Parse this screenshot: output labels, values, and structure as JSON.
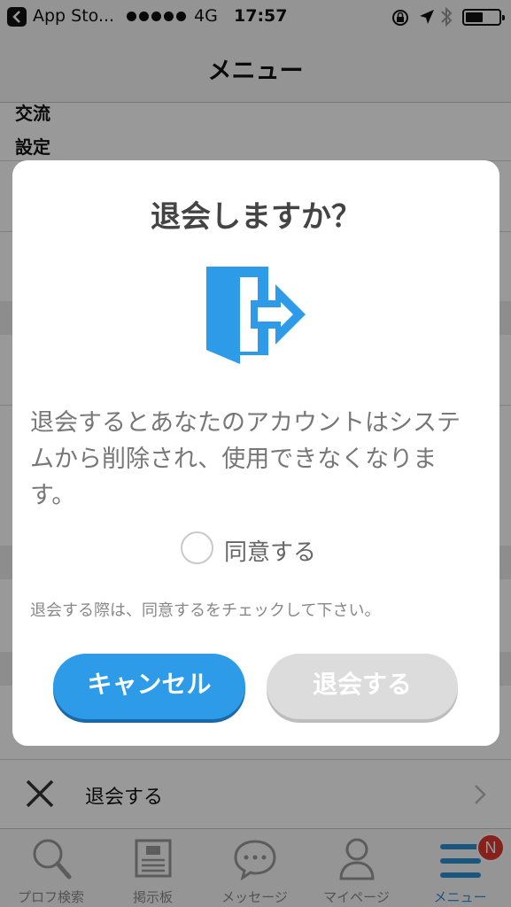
{
  "status_bar": {
    "back_app": "App Sto...",
    "network": "4G",
    "time": "17:57"
  },
  "navbar": {
    "title": "メニュー"
  },
  "menu": {
    "items": [
      {
        "label": "交流"
      },
      {
        "label": "設定"
      }
    ],
    "withdraw_row": {
      "label": "退会する",
      "icon": "close-icon"
    }
  },
  "dialog": {
    "title": "退会しますか？",
    "icon": "exit-door-arrow-icon",
    "body": "退会するとあなたのアカウントはシステムから削除され、使用できなくなります。",
    "agree_label": "同意する",
    "agree_checked": false,
    "note": "退会する際は、同意するをチェックして下さい。",
    "cancel_label": "キャンセル",
    "withdraw_label": "退会する",
    "withdraw_enabled": false,
    "accent_color": "#2d9be8"
  },
  "tabbar": {
    "tabs": [
      {
        "label": "プロフ検索",
        "icon": "search-icon"
      },
      {
        "label": "掲示板",
        "icon": "board-icon"
      },
      {
        "label": "メッセージ",
        "icon": "message-icon"
      },
      {
        "label": "マイページ",
        "icon": "person-icon"
      },
      {
        "label": "メニュー",
        "icon": "menu-icon",
        "active": true
      }
    ],
    "menu_badge": "N",
    "active_color": "#2a8fd6"
  }
}
